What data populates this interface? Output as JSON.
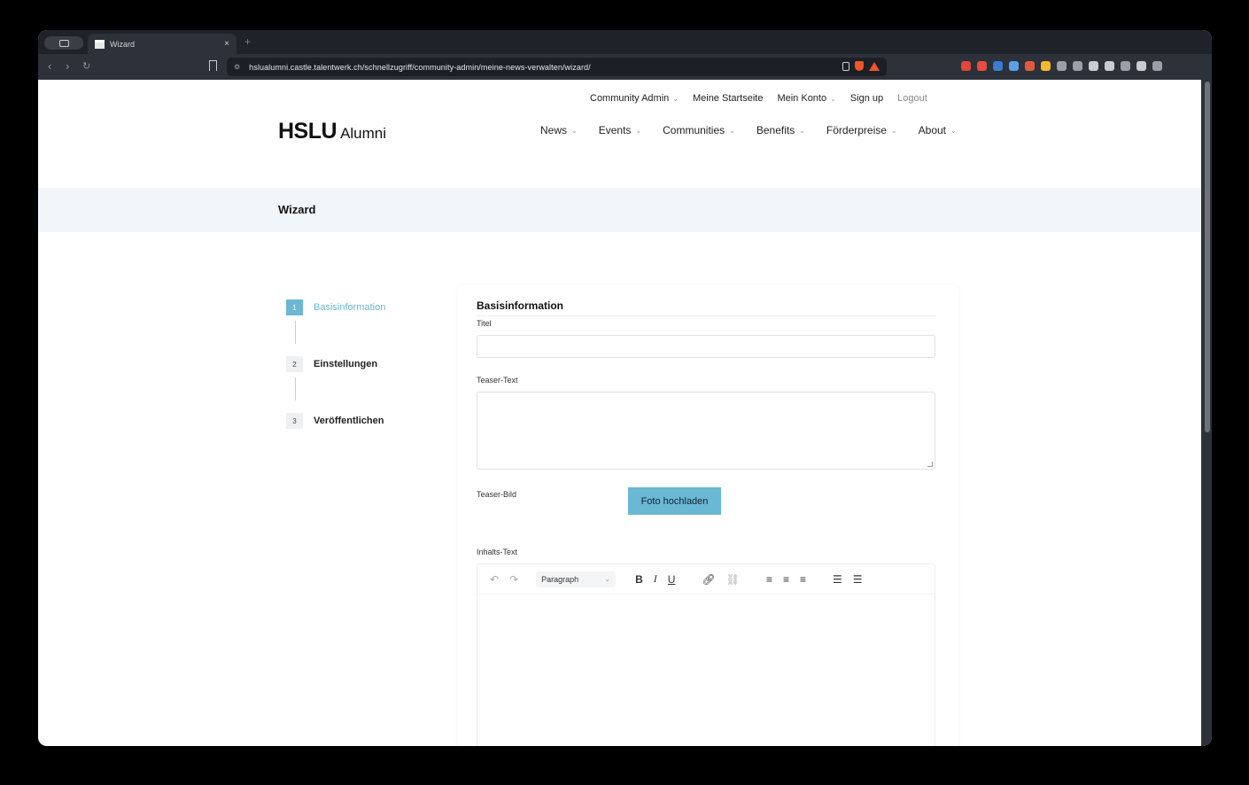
{
  "browser": {
    "tab_title": "Wizard",
    "close_glyph": "×",
    "new_tab_glyph": "+",
    "url": "hslualumni.castle.talentwerk.ch/schnellzugriff/community-admin/meine-news-verwalten/wizard/",
    "extension_colors": [
      "#e2473b",
      "#e84c3d",
      "#3a7bd5",
      "#5aa0e6",
      "#e05a3a",
      "#f5b82e",
      "#9ba0a8",
      "#9ba0a8",
      "#c9ccd2",
      "#c9ccd2",
      "#9ba0a8",
      "#c9ccd2",
      "#9ba0a8"
    ]
  },
  "site": {
    "logo_main": "HSLU",
    "logo_sub": "Alumni",
    "top_nav": [
      {
        "label": "Community Admin",
        "dropdown": true
      },
      {
        "label": "Meine Startseite",
        "dropdown": false
      },
      {
        "label": "Mein Konto",
        "dropdown": true
      },
      {
        "label": "Sign up",
        "dropdown": false
      },
      {
        "label": "Logout",
        "dropdown": false
      }
    ],
    "main_nav": [
      {
        "label": "News"
      },
      {
        "label": "Events"
      },
      {
        "label": "Communities"
      },
      {
        "label": "Benefits"
      },
      {
        "label": "Förderpreise"
      },
      {
        "label": "About"
      }
    ],
    "accent": "#6ab8d3"
  },
  "page": {
    "title": "Wizard"
  },
  "wizard": {
    "steps": [
      {
        "num": "1",
        "label": "Basisinformation",
        "active": true
      },
      {
        "num": "2",
        "label": "Einstellungen",
        "active": false
      },
      {
        "num": "3",
        "label": "Veröffentlichen",
        "active": false
      }
    ],
    "form": {
      "title": "Basisinformation",
      "titel_label": "Titel",
      "titel_value": "",
      "teaser_text_label": "Teaser-Text",
      "teaser_text_value": "",
      "teaser_bild_label": "Teaser-Bild",
      "upload_button": "Foto hochladen",
      "inhalts_text_label": "Inhalts-Text",
      "editor_block_format": "Paragraph"
    }
  }
}
